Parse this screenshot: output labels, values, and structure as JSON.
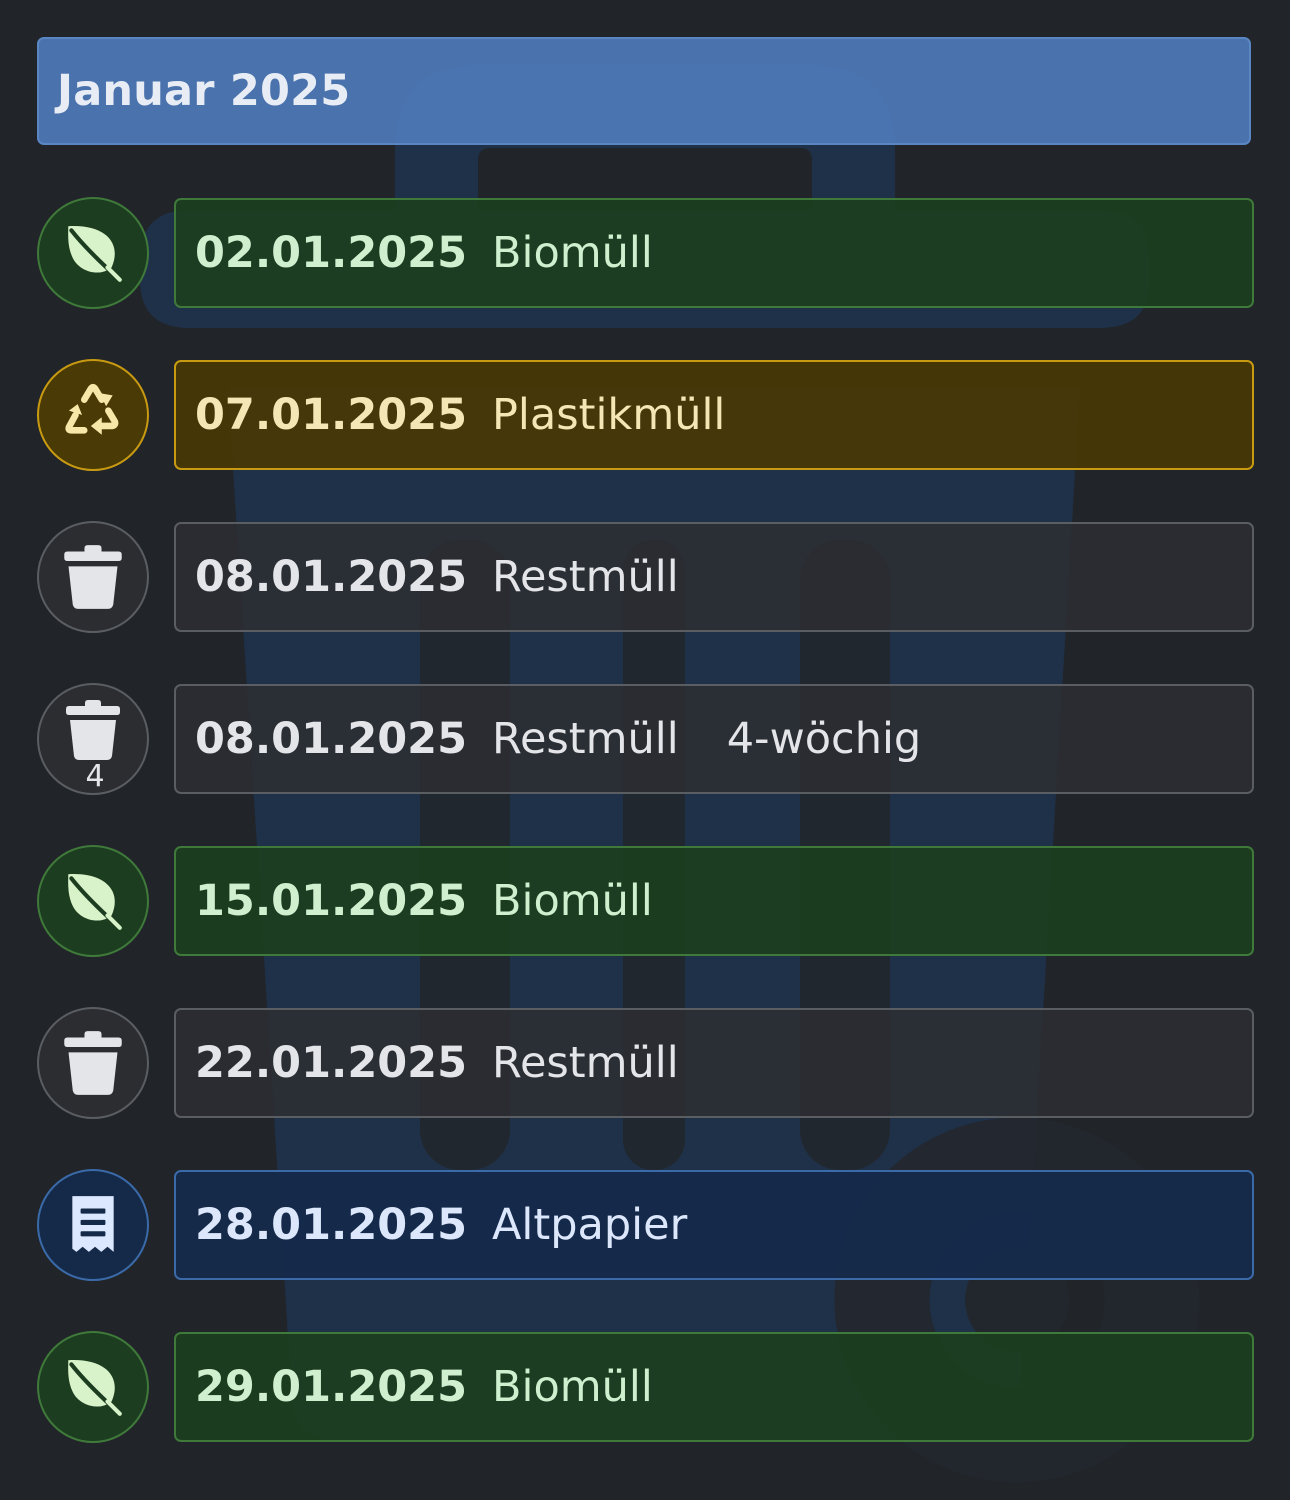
{
  "month": {
    "title": "Januar 2025"
  },
  "colors": {
    "bio": "#1c3e1e",
    "plastic": "#483804",
    "rest": "#2c2e32",
    "paper": "#142a4a",
    "header": "#4e7ab8"
  },
  "entries": [
    {
      "date": "02.01.2025",
      "type": "Biomüll",
      "extra": "",
      "icon": "leaf-icon",
      "category": "bio"
    },
    {
      "date": "07.01.2025",
      "type": "Plastikmüll",
      "extra": "",
      "icon": "recycle-icon",
      "category": "plastic"
    },
    {
      "date": "08.01.2025",
      "type": "Restmüll",
      "extra": "",
      "icon": "trash-icon",
      "category": "rest"
    },
    {
      "date": "08.01.2025",
      "type": "Restmüll",
      "extra": "4-wöchig",
      "icon": "trash-4-icon",
      "badge": "4",
      "category": "rest"
    },
    {
      "date": "15.01.2025",
      "type": "Biomüll",
      "extra": "",
      "icon": "leaf-icon",
      "category": "bio"
    },
    {
      "date": "22.01.2025",
      "type": "Restmüll",
      "extra": "",
      "icon": "trash-icon",
      "category": "rest"
    },
    {
      "date": "28.01.2025",
      "type": "Altpapier",
      "extra": "",
      "icon": "receipt-icon",
      "category": "paper"
    },
    {
      "date": "29.01.2025",
      "type": "Biomüll",
      "extra": "",
      "icon": "leaf-icon",
      "category": "bio"
    }
  ]
}
